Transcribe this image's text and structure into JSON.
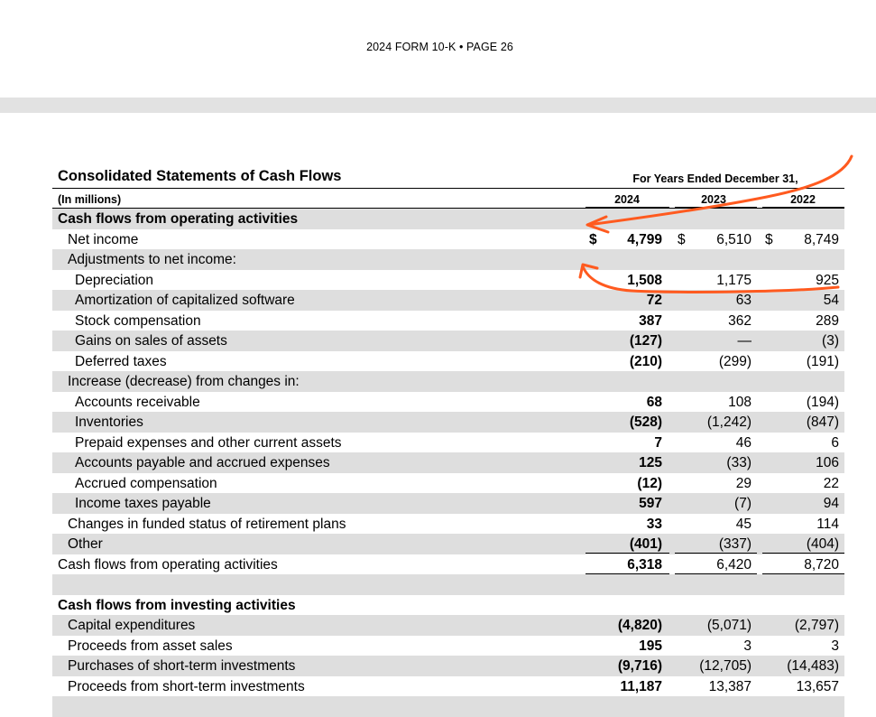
{
  "page_header": "2024 FORM 10-K • PAGE 26",
  "statement": {
    "title": "Consolidated Statements of Cash Flows",
    "units": "(In millions)",
    "period_header": "For Years Ended December 31,",
    "years": [
      "2024",
      "2023",
      "2022"
    ]
  },
  "rows": [
    {
      "label": "Cash flows from operating activities",
      "indent": 0,
      "bold": true,
      "shade": true,
      "v": [
        "",
        "",
        ""
      ]
    },
    {
      "label": "Net income",
      "indent": 1,
      "shade": false,
      "dollar": true,
      "v": [
        "4,799",
        "6,510",
        "8,749"
      ]
    },
    {
      "label": "Adjustments to net income:",
      "indent": 1,
      "shade": true,
      "v": [
        "",
        "",
        ""
      ]
    },
    {
      "label": "Depreciation",
      "indent": 2,
      "shade": false,
      "v": [
        "1,508",
        "1,175",
        "925"
      ]
    },
    {
      "label": "Amortization of capitalized software",
      "indent": 2,
      "shade": true,
      "v": [
        "72",
        "63",
        "54"
      ]
    },
    {
      "label": "Stock compensation",
      "indent": 2,
      "shade": false,
      "v": [
        "387",
        "362",
        "289"
      ]
    },
    {
      "label": "Gains on sales of assets",
      "indent": 2,
      "shade": true,
      "v": [
        "(127)",
        "—",
        "(3)"
      ]
    },
    {
      "label": "Deferred taxes",
      "indent": 2,
      "shade": false,
      "v": [
        "(210)",
        "(299)",
        "(191)"
      ]
    },
    {
      "label": "Increase (decrease) from changes in:",
      "indent": 1,
      "shade": true,
      "v": [
        "",
        "",
        ""
      ]
    },
    {
      "label": "Accounts receivable",
      "indent": 2,
      "shade": false,
      "v": [
        "68",
        "108",
        "(194)"
      ]
    },
    {
      "label": "Inventories",
      "indent": 2,
      "shade": true,
      "v": [
        "(528)",
        "(1,242)",
        "(847)"
      ]
    },
    {
      "label": "Prepaid expenses and other current assets",
      "indent": 2,
      "shade": false,
      "v": [
        "7",
        "46",
        "6"
      ]
    },
    {
      "label": "Accounts payable and accrued expenses",
      "indent": 2,
      "shade": true,
      "v": [
        "125",
        "(33)",
        "106"
      ]
    },
    {
      "label": "Accrued compensation",
      "indent": 2,
      "shade": false,
      "v": [
        "(12)",
        "29",
        "22"
      ]
    },
    {
      "label": "Income taxes payable",
      "indent": 2,
      "shade": true,
      "v": [
        "597",
        "(7)",
        "94"
      ]
    },
    {
      "label": "Changes in funded status of retirement plans",
      "indent": 1,
      "shade": false,
      "v": [
        "33",
        "45",
        "114"
      ]
    },
    {
      "label": "Other",
      "indent": 1,
      "shade": true,
      "underline": true,
      "v": [
        "(401)",
        "(337)",
        "(404)"
      ]
    },
    {
      "label": "Cash flows from operating activities",
      "indent": 0,
      "shade": false,
      "total": true,
      "v": [
        "6,318",
        "6,420",
        "8,720"
      ]
    },
    {
      "label": "",
      "indent": 0,
      "shade": true,
      "v": [
        "",
        "",
        ""
      ]
    },
    {
      "label": "Cash flows from investing activities",
      "indent": 0,
      "bold": true,
      "shade": false,
      "v": [
        "",
        "",
        ""
      ]
    },
    {
      "label": "Capital expenditures",
      "indent": 1,
      "shade": true,
      "v": [
        "(4,820)",
        "(5,071)",
        "(2,797)"
      ]
    },
    {
      "label": "Proceeds from asset sales",
      "indent": 1,
      "shade": false,
      "v": [
        "195",
        "3",
        "3"
      ]
    },
    {
      "label": "Purchases of short-term investments",
      "indent": 1,
      "shade": true,
      "v": [
        "(9,716)",
        "(12,705)",
        "(14,483)"
      ]
    },
    {
      "label": "Proceeds from short-term investments",
      "indent": 1,
      "shade": false,
      "v": [
        "11,187",
        "13,387",
        "13,657"
      ]
    },
    {
      "label": "",
      "indent": 0,
      "shade": true,
      "v": [
        "",
        "",
        ""
      ]
    }
  ],
  "dollar_sign": "$",
  "annotation_color": "#ff5a1f"
}
